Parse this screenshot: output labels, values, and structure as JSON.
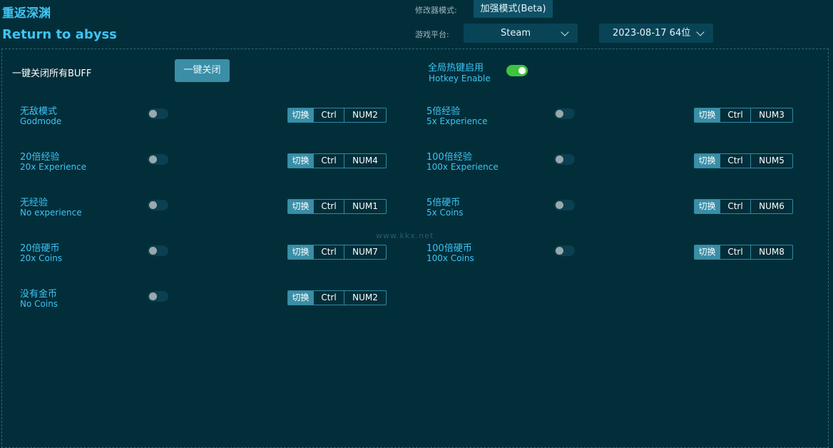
{
  "header": {
    "title_cn": "重返深渊",
    "title_en": "Return to abyss",
    "mode_label": "修改器模式:",
    "mode_value": "加强模式(Beta)",
    "platform_label": "游戏平台:",
    "platform_value": "Steam",
    "version_value": "2023-08-17 64位"
  },
  "controls": {
    "all_off_label": "一键关闭所有BUFF",
    "all_off_button": "一键关闭",
    "hotkey_cn": "全局热键启用",
    "hotkey_en": "Hotkey Enable",
    "hotkey_enabled": true
  },
  "switch_label": "切换",
  "cheats_left": [
    {
      "cn": "无敌模式",
      "en": "Godmode",
      "mod": "Ctrl",
      "key": "NUM2",
      "enabled": false
    },
    {
      "cn": "20倍经验",
      "en": "20x Experience",
      "mod": "Ctrl",
      "key": "NUM4",
      "enabled": false
    },
    {
      "cn": "无经验",
      "en": "No experience",
      "mod": "Ctrl",
      "key": "NUM1",
      "enabled": false
    },
    {
      "cn": "20倍硬币",
      "en": "20x Coins",
      "mod": "Ctrl",
      "key": "NUM7",
      "enabled": false
    },
    {
      "cn": "没有金币",
      "en": "No Coins",
      "mod": "Ctrl",
      "key": "NUM2",
      "enabled": false
    }
  ],
  "cheats_right": [
    {
      "cn": "5倍经验",
      "en": "5x Experience",
      "mod": "Ctrl",
      "key": "NUM3",
      "enabled": false
    },
    {
      "cn": "100倍经验",
      "en": "100x Experience",
      "mod": "Ctrl",
      "key": "NUM5",
      "enabled": false
    },
    {
      "cn": "5倍硬币",
      "en": "5x Coins",
      "mod": "Ctrl",
      "key": "NUM6",
      "enabled": false
    },
    {
      "cn": "100倍硬币",
      "en": "100x Coins",
      "mod": "Ctrl",
      "key": "NUM8",
      "enabled": false
    }
  ],
  "watermark": "www.kkx.net",
  "colors": {
    "background": "#022e3a",
    "accent": "#3ec4f3",
    "toggle_on": "#3ec43e",
    "button": "#3a8ea6"
  }
}
